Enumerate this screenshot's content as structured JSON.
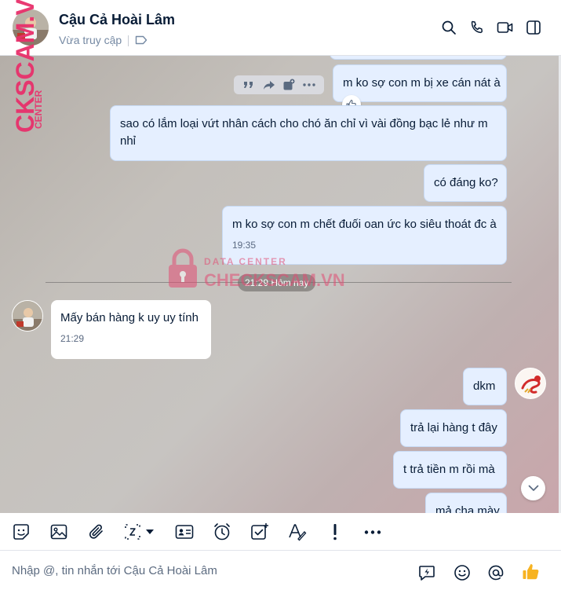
{
  "header": {
    "contact_name": "Cậu Cả Hoài Lâm",
    "status": "Vừa truy cập"
  },
  "messages": [
    {
      "id": "m1",
      "side": "me",
      "text": "m ko sợ con m bị xe cán nát à",
      "reaction": "like"
    },
    {
      "id": "m2",
      "side": "me",
      "lines": [
        "sao có lắm loại vứt nhân cách cho chó ăn chỉ vì vài đồng bạc lẻ như m",
        "nhỉ"
      ]
    },
    {
      "id": "m3",
      "side": "me",
      "text": "có đáng ko?"
    },
    {
      "id": "m4",
      "side": "me",
      "text": "m ko sợ con m chết đuối oan ức ko siêu thoát đc à",
      "time": "19:35"
    },
    {
      "id": "m5",
      "side": "them",
      "text": "Mấy bán hàng k uy uy tính",
      "time": "21:29"
    },
    {
      "id": "m6",
      "side": "me",
      "text": "dkm"
    },
    {
      "id": "m7",
      "side": "me",
      "text": "trả lại hàng t đây"
    },
    {
      "id": "m8",
      "side": "me",
      "text": "t trả tiền m rồi mà"
    },
    {
      "id": "m9",
      "side": "me",
      "text": "mả cha mày"
    }
  ],
  "day_separator": "21:29 Hôm nay",
  "watermark": {
    "small": "DATA CENTER",
    "big": "CHECKSCAM.VN",
    "side_big": "CKSCAM.VN",
    "side_small": "CENTER"
  },
  "toolbar": {
    "items": [
      "sticker-icon",
      "image-icon",
      "attachment-icon",
      "screenshot-icon",
      "contact-card-icon",
      "reminder-icon",
      "task-icon",
      "text-format-icon",
      "important-icon",
      "more-icon"
    ]
  },
  "composer": {
    "placeholder": "Nhập @, tin nhắn tới Cậu Cả Hoài Lâm"
  },
  "colors": {
    "my_bubble": "#e5efff",
    "their_bubble": "#ffffff",
    "accent": "#0068ff",
    "watermark": "#e8306b"
  }
}
